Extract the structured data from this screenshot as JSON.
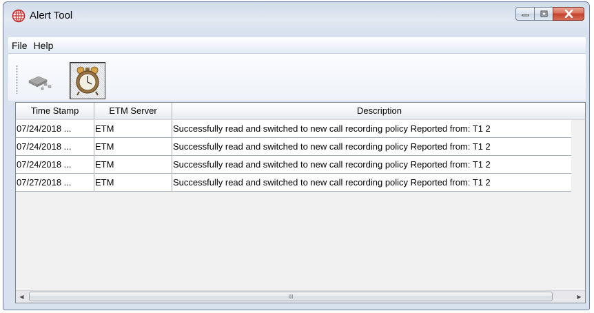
{
  "window": {
    "title": "Alert Tool",
    "icon": "globe-icon",
    "caption_buttons": [
      "minimize-icon",
      "maximize-icon",
      "close-icon"
    ]
  },
  "menu": {
    "items": [
      "File",
      "Help"
    ]
  },
  "toolbar": {
    "buttons": [
      {
        "icon": "network-icon",
        "state": "disabled"
      },
      {
        "icon": "alarm-clock-icon",
        "state": "pressed"
      }
    ]
  },
  "table": {
    "columns": [
      "Time Stamp",
      "ETM Server",
      "Description"
    ],
    "rows": [
      [
        "07/24/2018 ...",
        "ETM",
        "Successfully read and switched to new call recording policy Reported from: T1 2"
      ],
      [
        "07/24/2018 ...",
        "ETM",
        "Successfully read and switched to new call recording policy Reported from: T1 2"
      ],
      [
        "07/24/2018 ...",
        "ETM",
        "Successfully read and switched to new call recording policy Reported from: T1 2"
      ],
      [
        "07/27/2018 ...",
        "ETM",
        "Successfully read and switched to new call recording policy Reported from: T1 2"
      ]
    ]
  },
  "scrollbar": {
    "grip": "III"
  },
  "colors": {
    "close_button": "#c4442d",
    "titlebar": "#cfdbe9",
    "menubar": "#e3eaf4"
  }
}
